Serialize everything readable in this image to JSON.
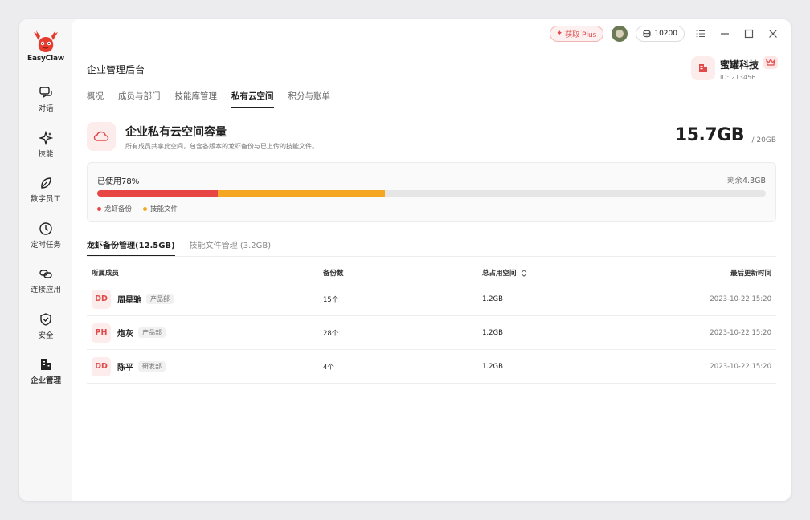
{
  "app": {
    "name": "EasyClaw"
  },
  "sidebar": {
    "items": [
      {
        "label": "对话",
        "icon": "chat-icon"
      },
      {
        "label": "技能",
        "icon": "sparkle-icon"
      },
      {
        "label": "数字员工",
        "icon": "leaf-icon"
      },
      {
        "label": "定时任务",
        "icon": "clock-icon"
      },
      {
        "label": "连接应用",
        "icon": "link-icon"
      },
      {
        "label": "安全",
        "icon": "shield-icon"
      },
      {
        "label": "企业管理",
        "icon": "building-icon"
      }
    ]
  },
  "topbar": {
    "plus_label": "获取 Plus",
    "coins": "10200"
  },
  "header": {
    "title": "企业管理后台"
  },
  "org": {
    "name": "蜜罐科技",
    "id": "ID: 213456"
  },
  "tabs": [
    {
      "label": "概况"
    },
    {
      "label": "成员与部门"
    },
    {
      "label": "技能库管理"
    },
    {
      "label": "私有云空间"
    },
    {
      "label": "积分与账单"
    }
  ],
  "capacity": {
    "title": "企业私有云空间容量",
    "desc": "所有成员共享此空间，包含各版本的龙虾备份与已上传的技能文件。",
    "used": "15.7GB",
    "total": "/ 20GB",
    "used_label": "已使用78%",
    "remaining_label": "剩余4.3GB",
    "backup_fraction": 0.18,
    "skills_fraction": 0.25,
    "legend": [
      {
        "label": "龙虾备份",
        "color": "#e84545"
      },
      {
        "label": "技能文件",
        "color": "#f5a623"
      }
    ]
  },
  "subtabs": [
    {
      "label": "龙虾备份管理(12.5GB)"
    },
    {
      "label": "技能文件管理 (3.2GB)"
    }
  ],
  "table": {
    "headers": [
      "所属成员",
      "备份数",
      "总占用空间",
      "最后更新时间"
    ],
    "rows": [
      {
        "initials": "DD",
        "name": "周星驰",
        "dept": "产品部",
        "backups": "15个",
        "size": "1.2GB",
        "updated": "2023-10-22 15:20"
      },
      {
        "initials": "PH",
        "name": "炮灰",
        "dept": "产品部",
        "backups": "28个",
        "size": "1.2GB",
        "updated": "2023-10-22 15:20"
      },
      {
        "initials": "DD",
        "name": "陈平",
        "dept": "研发部",
        "backups": "4个",
        "size": "1.2GB",
        "updated": "2023-10-22 15:20"
      }
    ]
  }
}
